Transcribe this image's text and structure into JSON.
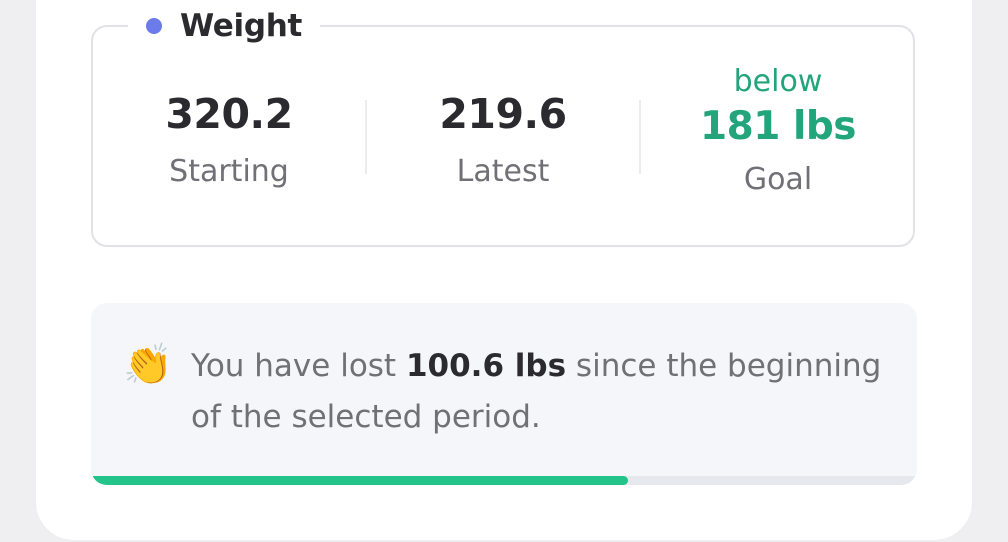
{
  "weight_card": {
    "title": "Weight",
    "accent_color": "#6b7bea",
    "starting": {
      "value": "320.2",
      "label": "Starting"
    },
    "latest": {
      "value": "219.6",
      "label": "Latest"
    },
    "goal": {
      "prefix": "below",
      "value": "181 lbs",
      "label": "Goal",
      "color": "#22a57a"
    }
  },
  "summary": {
    "icon": "clapping-hands-icon",
    "emoji": "👏",
    "text_before": "You have lost ",
    "highlight": "100.6 lbs",
    "text_after": " since the beginning of the selected period.",
    "progress_fraction": 0.65,
    "progress_color": "#22c48a"
  }
}
